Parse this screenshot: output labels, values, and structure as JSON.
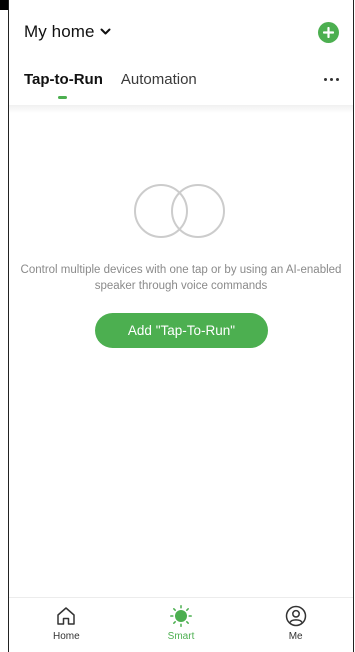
{
  "header": {
    "home_title": "My home",
    "tabs": [
      {
        "label": "Tap-to-Run",
        "active": true
      },
      {
        "label": "Automation",
        "active": false
      }
    ]
  },
  "empty_state": {
    "description": "Control multiple devices with one tap or by using an AI-enabled speaker through voice commands",
    "button_label": "Add \"Tap-To-Run\""
  },
  "bottom_nav": {
    "items": [
      {
        "label": "Home",
        "icon": "home-icon",
        "active": false
      },
      {
        "label": "Smart",
        "icon": "sun-icon",
        "active": true
      },
      {
        "label": "Me",
        "icon": "user-icon",
        "active": false
      }
    ]
  },
  "colors": {
    "accent": "#4caf50",
    "text_muted": "#8a8a8a",
    "illustration_stroke": "#cccccc"
  }
}
